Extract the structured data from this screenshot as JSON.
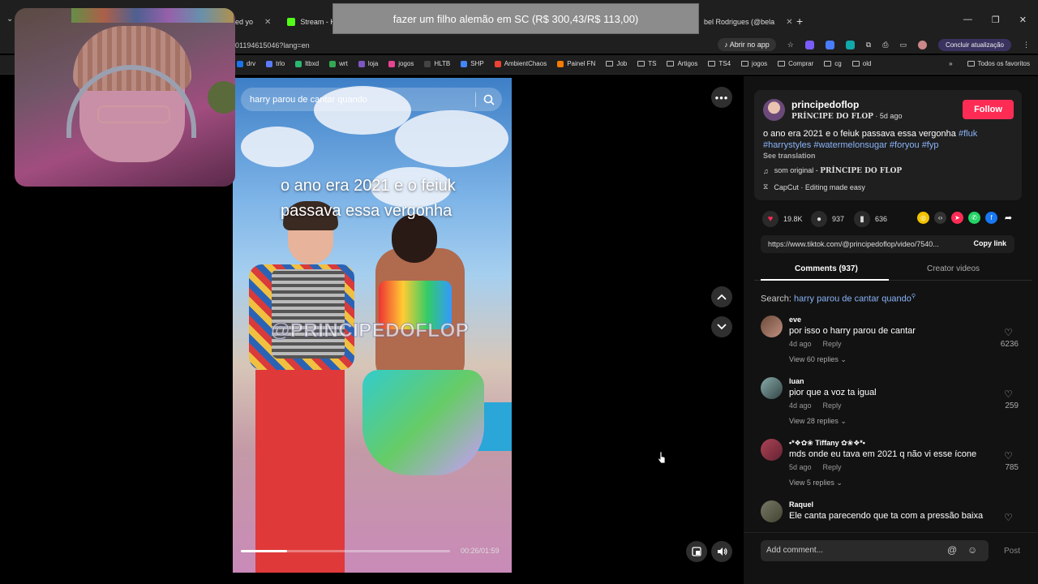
{
  "browser": {
    "tabs": [
      {
        "label": "ioned yo"
      },
      {
        "label": "Stream - Kick"
      },
      {
        "label": "bel Rodrigues (@bela"
      }
    ],
    "url": "01194615046?lang=en",
    "open_app_label": "Abrir no app",
    "update_label": "Concluir atualização",
    "bookmarks": [
      "drv",
      "trlo",
      "ltbxd",
      "wrt",
      "loja",
      "jogos",
      "HLTB",
      "SHP",
      "AmbientChaos",
      "Painel FN",
      "Job",
      "TS",
      "Artigos",
      "TS4",
      "jogos",
      "Comprar",
      "cg",
      "old"
    ],
    "all_bookmarks_label": "Todos os favoritos"
  },
  "price_tooltip": "fazer um filho alemão em SC (R$ 300,43/R$ 113,00)",
  "video": {
    "search_query": "harry parou de cantar quando",
    "caption_line1": "o ano era 2021 e o feiuk",
    "caption_line2": "passava essa vergonha",
    "watermark": "@PRINCIPEDOFLOP",
    "time": "00:26/01:59",
    "progress_fraction": 0.22
  },
  "post": {
    "username": "principedoflop",
    "display_name": "PRÍNCIPE DO FLOP",
    "age": "5d ago",
    "follow_label": "Follow",
    "description": "o ano era 2021 e o feiuk passava essa vergonha",
    "hashtags": [
      "#fluk",
      "#harrystyles",
      "#watermelonsugar",
      "#foryou",
      "#fyp"
    ],
    "see_translation": "See translation",
    "sound_prefix": "som original - ",
    "sound_author": "PRÍNCIPE DO FLOP",
    "capcut": "CapCut · Editing made easy",
    "likes": "19.8K",
    "comments_count": "937",
    "saves": "636",
    "link": "https://www.tiktok.com/@principedoflop/video/7540...",
    "copy_link": "Copy link",
    "tab_comments": "Comments (937)",
    "tab_creator": "Creator videos",
    "search_prefix": "Search: ",
    "search_query": "harry parou de cantar quando"
  },
  "comments": [
    {
      "user": "eve",
      "text": "por isso o harry parou de cantar",
      "age": "4d ago",
      "reply": "Reply",
      "replies": "View 60 replies ⌄",
      "likes": "6236"
    },
    {
      "user": "luan",
      "text": "pior que a voz ta igual",
      "age": "4d ago",
      "reply": "Reply",
      "replies": "View 28 replies ⌄",
      "likes": "259"
    },
    {
      "user": "•*❖✿❀ Tiffany ✿❀❖*•",
      "text": "mds onde eu tava em 2021 q não vi esse ícone",
      "age": "5d ago",
      "reply": "Reply",
      "replies": "View 5 replies ⌄",
      "likes": "785"
    },
    {
      "user": "Raquel",
      "text": "Ele canta parecendo que ta com a pressão baixa",
      "age": "",
      "reply": "",
      "replies": "",
      "likes": ""
    }
  ],
  "composer": {
    "placeholder": "Add comment...",
    "post_label": "Post"
  },
  "colors": {
    "follow": "#fe2c55",
    "hashtag": "#8ab4f8",
    "panel_bg": "#121212"
  }
}
